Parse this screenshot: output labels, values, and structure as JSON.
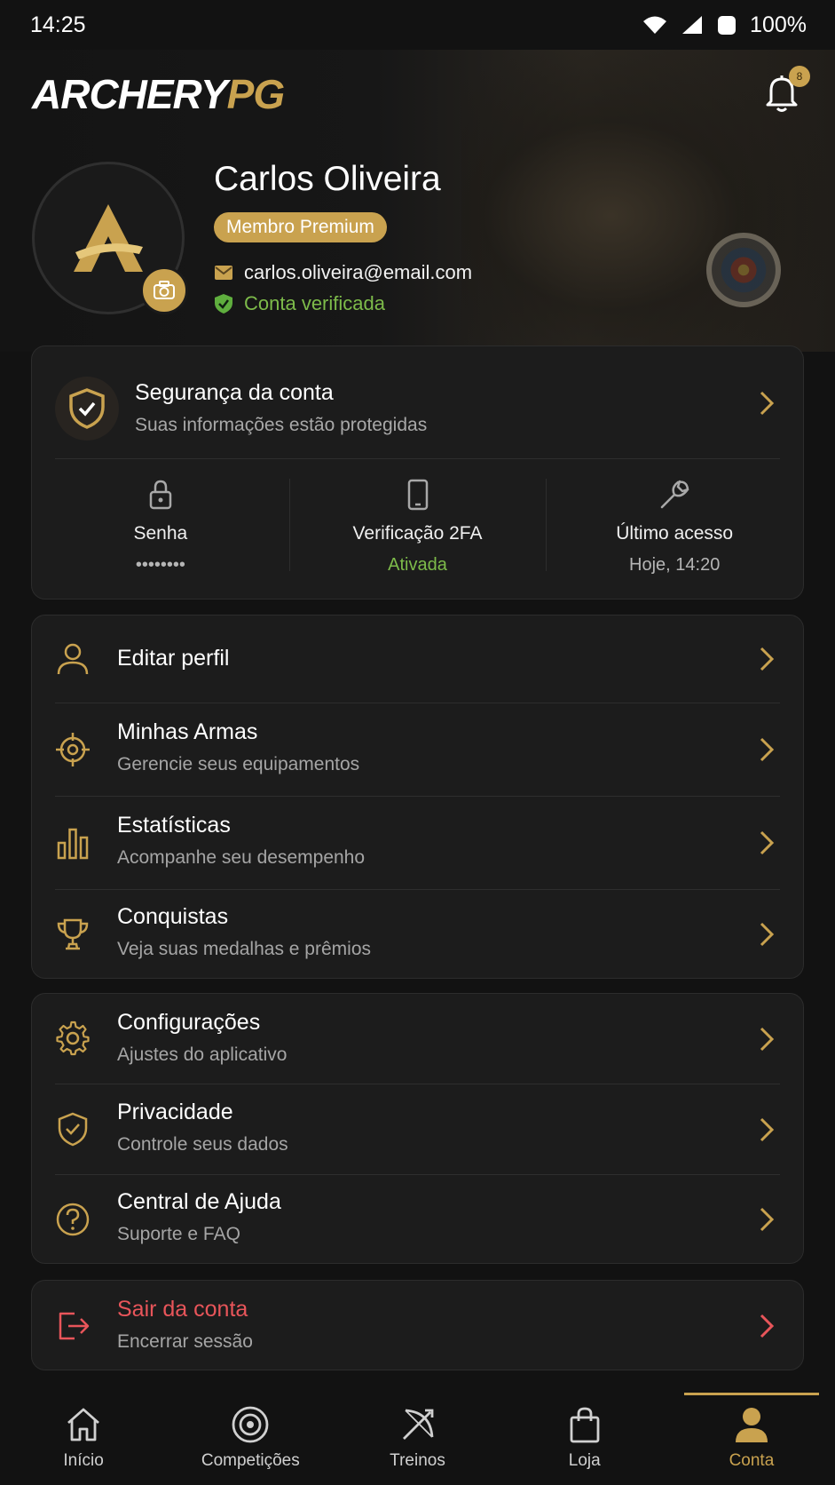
{
  "status": {
    "time": "14:25",
    "battery": "100%"
  },
  "brand": {
    "part1": "ARCHERY",
    "part2": "PG",
    "notification_count": "8"
  },
  "profile": {
    "name": "Carlos Oliveira",
    "badge": "Membro Premium",
    "email": "carlos.oliveira@email.com",
    "verified": "Conta verificada"
  },
  "security": {
    "title": "Segurança da conta",
    "subtitle": "Suas informações estão protegidas",
    "stats": [
      {
        "label": "Senha",
        "value": "••••••••",
        "icon": "lock-icon"
      },
      {
        "label": "Verificação 2FA",
        "value": "Ativada",
        "icon": "phone-icon"
      },
      {
        "label": "Último acesso",
        "value": "Hoje, 14:20",
        "icon": "wrench-icon"
      }
    ]
  },
  "menu_group_1": [
    {
      "title": "Editar perfil",
      "icon": "user-icon"
    },
    {
      "title": "Minhas Armas",
      "subtitle": "Gerencie seus equipamentos",
      "icon": "crosshair-icon"
    },
    {
      "title": "Estatísticas",
      "subtitle": "Acompanhe seu desempenho",
      "icon": "bar-chart-icon"
    },
    {
      "title": "Conquistas",
      "subtitle": "Veja suas medalhas e prêmios",
      "icon": "trophy-icon"
    }
  ],
  "menu_group_2": [
    {
      "title": "Configurações",
      "subtitle": "Ajustes do aplicativo",
      "icon": "gear-icon"
    },
    {
      "title": "Privacidade",
      "subtitle": "Controle seus dados",
      "icon": "shield-check-icon"
    },
    {
      "title": "Central de Ajuda",
      "subtitle": "Suporte e FAQ",
      "icon": "help-icon"
    }
  ],
  "logout": {
    "title": "Sair da conta",
    "subtitle": "Encerrar sessão"
  },
  "nav": [
    {
      "label": "Início",
      "icon": "home-icon"
    },
    {
      "label": "Competições",
      "icon": "target-icon"
    },
    {
      "label": "Treinos",
      "icon": "bow-icon"
    },
    {
      "label": "Loja",
      "icon": "bag-icon"
    },
    {
      "label": "Conta",
      "icon": "person-icon",
      "active": true
    }
  ],
  "colors": {
    "accent": "#c9a24f",
    "success": "#7dbb4a",
    "danger": "#e8555a",
    "background": "#121212",
    "card": "#1c1c1c"
  }
}
